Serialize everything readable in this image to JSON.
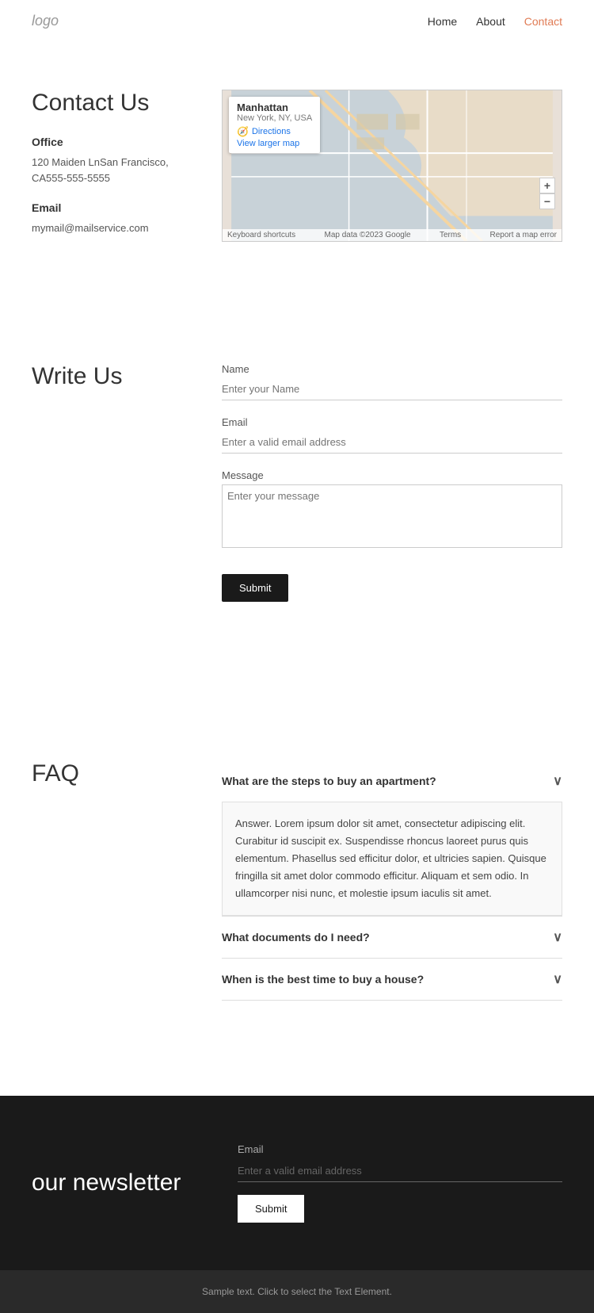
{
  "nav": {
    "logo": "logo",
    "links": [
      {
        "label": "Home",
        "active": false
      },
      {
        "label": "About",
        "active": false
      },
      {
        "label": "Contact",
        "active": true
      }
    ]
  },
  "contact": {
    "title": "Contact Us",
    "office_label": "Office",
    "address": "120 Maiden LnSan Francisco, CA555-555-5555",
    "email_label": "Email",
    "email": "mymail@mailservice.com",
    "map": {
      "location_name": "Manhattan",
      "location_sub": "New York, NY, USA",
      "directions_label": "Directions",
      "larger_map_label": "View larger map"
    }
  },
  "write_us": {
    "title": "Write Us",
    "name_label": "Name",
    "name_placeholder": "Enter your Name",
    "email_label": "Email",
    "email_placeholder": "Enter a valid email address",
    "message_label": "Message",
    "message_placeholder": "Enter your message",
    "submit_label": "Submit"
  },
  "faq": {
    "title": "FAQ",
    "items": [
      {
        "question": "What are the steps to buy an apartment?",
        "answer": "Answer. Lorem ipsum dolor sit amet, consectetur adipiscing elit. Curabitur id suscipit ex. Suspendisse rhoncus laoreet purus quis elementum. Phasellus sed efficitur dolor, et ultricies sapien. Quisque fringilla sit amet dolor commodo efficitur. Aliquam et sem odio. In ullamcorper nisi nunc, et molestie ipsum iaculis sit amet.",
        "open": true
      },
      {
        "question": "What documents do I need?",
        "answer": "",
        "open": false
      },
      {
        "question": "When is the best time to buy a house?",
        "answer": "",
        "open": false
      }
    ]
  },
  "newsletter": {
    "title": "our newsletter",
    "email_label": "Email",
    "email_placeholder": "Enter a valid email address",
    "submit_label": "Submit"
  },
  "footer": {
    "text": "Sample text. Click to select the Text Element."
  }
}
